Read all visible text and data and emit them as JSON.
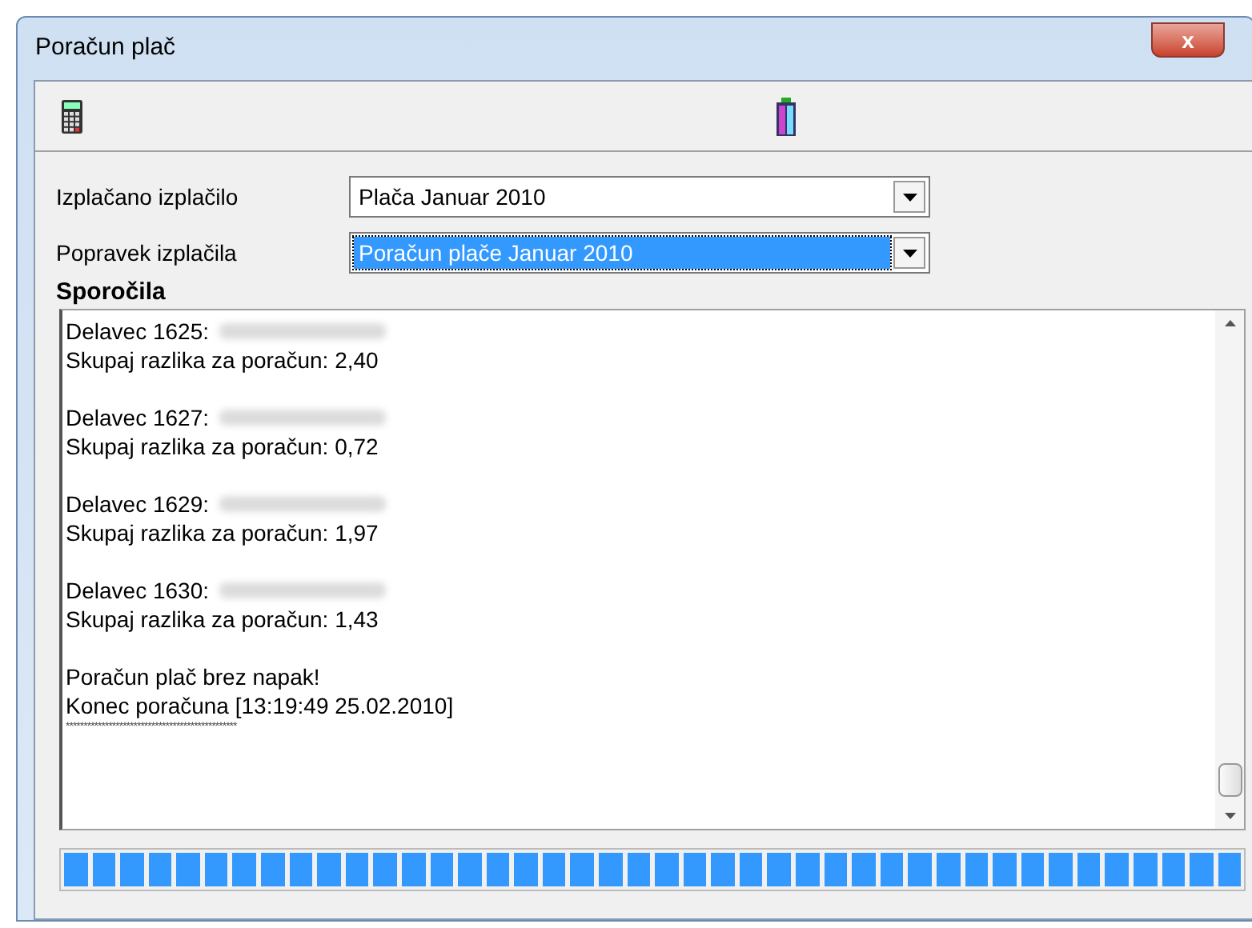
{
  "window": {
    "title": "Poračun plač",
    "close": "x"
  },
  "fields": [
    {
      "label": "Izplačano izplačilo",
      "value": "Plača Januar 2010",
      "selected": false
    },
    {
      "label": "Popravek izplačila",
      "value": "Poračun plače Januar 2010",
      "selected": true
    }
  ],
  "messages": {
    "title": "Sporočila",
    "lines": [
      {
        "kind": "worker",
        "text": "Delavec 1625:"
      },
      {
        "kind": "line",
        "text": "Skupaj razlika za poračun: 2,40"
      },
      {
        "kind": "blank"
      },
      {
        "kind": "worker",
        "text": "Delavec 1627:"
      },
      {
        "kind": "line",
        "text": "Skupaj razlika za poračun: 0,72"
      },
      {
        "kind": "blank"
      },
      {
        "kind": "worker",
        "text": "Delavec 1629:"
      },
      {
        "kind": "line",
        "text": "Skupaj razlika za poračun: 1,97"
      },
      {
        "kind": "blank"
      },
      {
        "kind": "worker",
        "text": "Delavec 1630:"
      },
      {
        "kind": "line",
        "text": "Skupaj razlika za poračun: 1,43"
      },
      {
        "kind": "blank"
      },
      {
        "kind": "line",
        "text": "Poračun plač brez napak!"
      },
      {
        "kind": "line",
        "text": "Konec poračuna [13:19:49 25.02.2010]"
      },
      {
        "kind": "small",
        "text": "************************************************"
      }
    ]
  },
  "progress": {
    "level": 1
  }
}
